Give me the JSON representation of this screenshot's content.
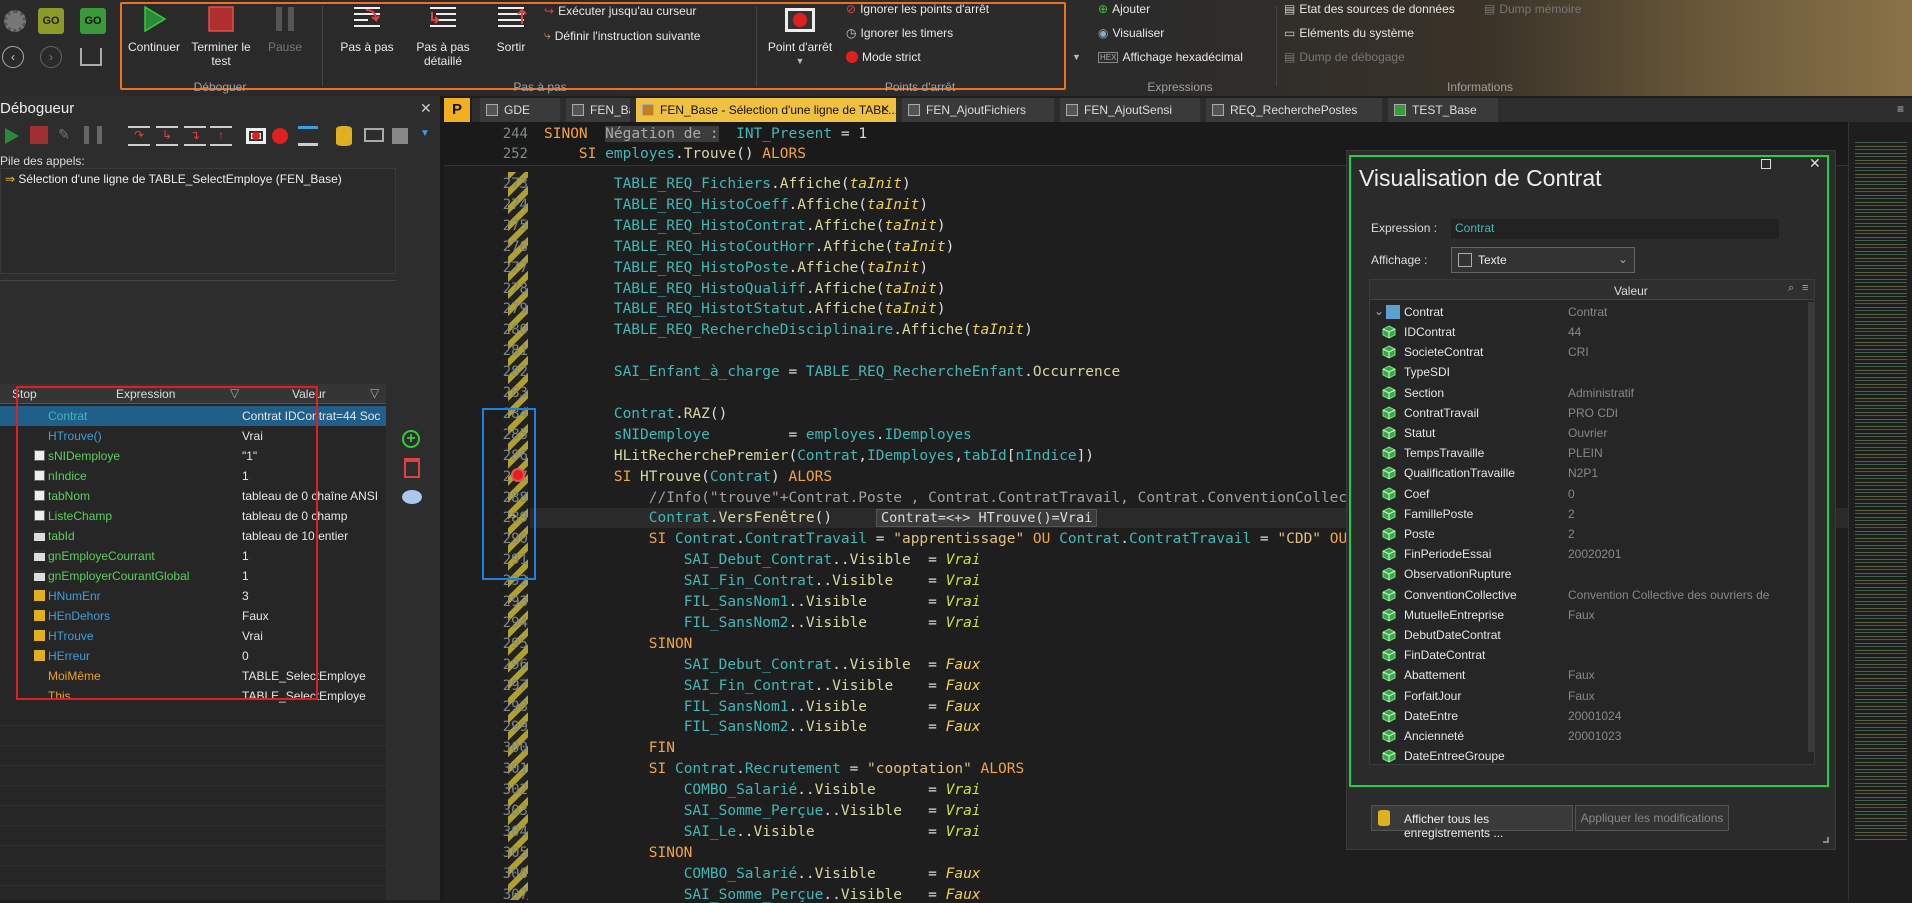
{
  "ribbon": {
    "debug_group": {
      "label": "Déboguer",
      "continue": "Continuer",
      "end_test": "Terminer le test",
      "pause": "Pause"
    },
    "step_group": {
      "label": "Pas à pas",
      "step": "Pas à pas",
      "step_detail": "Pas à pas détaillé",
      "exit": "Sortir",
      "run_to_cursor": "Exécuter jusqu'au curseur",
      "set_next": "Définir l'instruction suivante"
    },
    "breakpoints_group": {
      "label": "Points d'arrêt",
      "breakpoint": "Point d'arrêt",
      "ignore_bp": "Ignorer les points d'arrêt",
      "ignore_timers": "Ignorer les timers",
      "strict_mode": "Mode strict"
    },
    "expressions_group": {
      "label": "Expressions",
      "add": "Ajouter",
      "visualize": "Visualiser",
      "hex": "Affichage hexadécimal"
    },
    "info_group": {
      "label": "Informations",
      "datasources": "Etat des sources de données",
      "system": "Eléments du système",
      "debug_dump": "Dump de débogage",
      "memory_dump": "Dump mémoire"
    },
    "accent_orange": "#f07020",
    "stop_red": "#d04040"
  },
  "tabs": [
    {
      "label": "GDE"
    },
    {
      "label": "FEN_Base"
    },
    {
      "label": "FEN_Base - Sélection d'une ligne de TABL..."
    },
    {
      "label": "FEN_AjoutFichiers"
    },
    {
      "label": "FEN_AjoutSensi"
    },
    {
      "label": "REQ_RecherchePostes"
    },
    {
      "label": "TEST_Base"
    }
  ],
  "debugger": {
    "title": "Débogueur",
    "call_stack_label": "Pile des appels:",
    "call_stack_item": "Sélection d'une ligne de TABLE_SelectEmploye (FEN_Base)",
    "columns": {
      "stop": "Stop",
      "expression": "Expression",
      "value": "Valeur"
    },
    "rows": [
      {
        "expr": "Contrat",
        "value": "Contrat IDContrat=44 Soc",
        "color": "#3fb8b8",
        "icon": "none"
      },
      {
        "expr": "HTrouve()",
        "value": "Vrai",
        "color": "#3aa0e0",
        "icon": "none"
      },
      {
        "expr": "sNIDemploye",
        "value": "\"1\"",
        "color": "#5bd05b",
        "icon": "var"
      },
      {
        "expr": "nIndice",
        "value": "1",
        "color": "#5bd05b",
        "icon": "var"
      },
      {
        "expr": "tabNom",
        "value": "tableau de 0 chaîne ANSI",
        "color": "#5bd05b",
        "icon": "var"
      },
      {
        "expr": "ListeChamp",
        "value": "tableau de 0 champ",
        "color": "#5bd05b",
        "icon": "var"
      },
      {
        "expr": "tabId",
        "value": "tableau de 10 entier",
        "color": "#5bd05b",
        "icon": "local"
      },
      {
        "expr": "gnEmployeCourrant",
        "value": "1",
        "color": "#5bd05b",
        "icon": "local"
      },
      {
        "expr": "gnEmployerCourantGlobal",
        "value": "1",
        "color": "#5bd05b",
        "icon": "local"
      },
      {
        "expr": "HNumEnr",
        "value": "3",
        "color": "#3aa0e0",
        "icon": "h"
      },
      {
        "expr": "HEnDehors",
        "value": "Faux",
        "color": "#3aa0e0",
        "icon": "h"
      },
      {
        "expr": "HTrouve",
        "value": "Vrai",
        "color": "#3aa0e0",
        "icon": "h"
      },
      {
        "expr": "HErreur",
        "value": "0",
        "color": "#3aa0e0",
        "icon": "h"
      },
      {
        "expr": "MoiMême",
        "value": "TABLE_SelectEmploye",
        "color": "#f0a020",
        "icon": "none"
      },
      {
        "expr": "This",
        "value": "TABLE_SelectEmploye",
        "color": "#f0a020",
        "icon": "none"
      }
    ]
  },
  "code": {
    "sticky": [
      {
        "n": "244",
        "html": "<span class=\"kw\">SINON</span>  <span style=\"background:#3c3c3c;color:#aaa\">Négation de :</span>  <span class=\"id\">INT_Present</span> = 1"
      },
      {
        "n": "252",
        "html": "    <span class=\"kw\">SI</span> <span class=\"id\">employes</span>.<span class=\"fn\">Trouve</span>() <span class=\"kw\">ALORS</span>"
      }
    ],
    "lines": [
      {
        "n": "273",
        "html": "        <span class=\"tb2\">TABLE_REQ_Fichiers</span>.<span class=\"fn\">Affiche</span>(<span class=\"it\">taInit</span>)"
      },
      {
        "n": "274",
        "html": "        <span class=\"tb2\">TABLE_REQ_HistoCoeff</span>.<span class=\"fn\">Affiche</span>(<span class=\"it\">taInit</span>)"
      },
      {
        "n": "275",
        "html": "        <span class=\"tb2\">TABLE_REQ_HistoContrat</span>.<span class=\"fn\">Affiche</span>(<span class=\"it\">taInit</span>)"
      },
      {
        "n": "276",
        "html": "        <span class=\"tb2\">TABLE_REQ_HistoCoutHorr</span>.<span class=\"fn\">Affiche</span>(<span class=\"it\">taInit</span>)"
      },
      {
        "n": "277",
        "html": "        <span class=\"tb2\">TABLE_REQ_HistoPoste</span>.<span class=\"fn\">Affiche</span>(<span class=\"it\">taInit</span>)"
      },
      {
        "n": "278",
        "html": "        <span class=\"tb2\">TABLE_REQ_HistoQualiff</span>.<span class=\"fn\">Affiche</span>(<span class=\"it\">taInit</span>)"
      },
      {
        "n": "279",
        "html": "        <span class=\"tb2\">TABLE_REQ_HistotStatut</span>.<span class=\"fn\">Affiche</span>(<span class=\"it\">taInit</span>)"
      },
      {
        "n": "280",
        "html": "        <span class=\"tb2\">TABLE_REQ_RechercheDisciplinaire</span>.<span class=\"fn\">Affiche</span>(<span class=\"it\">taInit</span>)"
      },
      {
        "n": "281",
        "html": ""
      },
      {
        "n": "282",
        "html": "        <span class=\"tb2\">SAI_Enfant_à_charge</span> = <span class=\"tb2\">TABLE_REQ_RechercheEnfant</span>.<span class=\"fn\">Occurrence</span>"
      },
      {
        "n": "283",
        "html": ""
      },
      {
        "n": "284",
        "html": "        <span class=\"id\">Contrat</span>.<span class=\"fn\">RAZ</span>()"
      },
      {
        "n": "285",
        "html": "        <span class=\"id\">sNIDemploye</span>         = <span class=\"id\">employes</span>.<span class=\"id\">IDemployes</span>"
      },
      {
        "n": "286",
        "html": "        <span class=\"fn\">HLitRecherchePremier</span>(<span class=\"id\">Contrat</span>,<span class=\"id\">IDemployes</span>,<span class=\"id\">tabId</span>[<span class=\"id\">nIndice</span>])"
      },
      {
        "n": "287",
        "html": "        <span class=\"kw\">SI</span> <span class=\"fn\">HTrouve</span>(<span class=\"id\">Contrat</span>) <span class=\"kw\">ALORS</span>"
      },
      {
        "n": "288",
        "html": "            <span class=\"cm\">//Info(\"trouve\"+Contrat.Poste , Contrat.ContratTravail, Contrat.ConventionCollect</span>"
      },
      {
        "n": "289",
        "html": "            <span class=\"id\">Contrat</span>.<span class=\"fn\">VersFenêtre</span>()"
      },
      {
        "n": "290",
        "html": "            <span class=\"kw\">SI</span> <span class=\"id\">Contrat</span>.<span class=\"id\">ContratTravail</span> = <span class=\"str\">\"apprentissage\"</span> <span class=\"kw\">OU</span> <span class=\"id\">Contrat</span>.<span class=\"id\">ContratTravail</span> = <span class=\"str\">\"CDD\"</span> <span class=\"kw\">OU</span>"
      },
      {
        "n": "291",
        "html": "                <span class=\"tb2\">SAI_Debut_Contrat</span>..<span class=\"fn\">Visible</span>  = <span class=\"itv\">Vrai</span>"
      },
      {
        "n": "292",
        "html": "                <span class=\"tb2\">SAI_Fin_Contrat</span>..<span class=\"fn\">Visible</span>    = <span class=\"itv\">Vrai</span>"
      },
      {
        "n": "293",
        "html": "                <span class=\"tb2\">FIL_SansNom1</span>..<span class=\"fn\">Visible</span>       = <span class=\"itv\">Vrai</span>"
      },
      {
        "n": "294",
        "html": "                <span class=\"tb2\">FIL_SansNom2</span>..<span class=\"fn\">Visible</span>       = <span class=\"itv\">Vrai</span>"
      },
      {
        "n": "295",
        "html": "            <span class=\"kw\">SINON</span>"
      },
      {
        "n": "296",
        "html": "                <span class=\"tb2\">SAI_Debut_Contrat</span>..<span class=\"fn\">Visible</span>  = <span class=\"it\">Faux</span>"
      },
      {
        "n": "297",
        "html": "                <span class=\"tb2\">SAI_Fin_Contrat</span>..<span class=\"fn\">Visible</span>    = <span class=\"it\">Faux</span>"
      },
      {
        "n": "298",
        "html": "                <span class=\"tb2\">FIL_SansNom1</span>..<span class=\"fn\">Visible</span>       = <span class=\"it\">Faux</span>"
      },
      {
        "n": "299",
        "html": "                <span class=\"tb2\">FIL_SansNom2</span>..<span class=\"fn\">Visible</span>       = <span class=\"it\">Faux</span>"
      },
      {
        "n": "300",
        "html": "            <span class=\"kw\">FIN</span>"
      },
      {
        "n": "301",
        "html": "            <span class=\"kw\">SI</span> <span class=\"id\">Contrat</span>.<span class=\"id\">Recrutement</span> = <span class=\"str\">\"cooptation\"</span> <span class=\"kw\">ALORS</span>"
      },
      {
        "n": "302",
        "html": "                <span class=\"tb2\">COMBO_Salarié</span>..<span class=\"fn\">Visible</span>      = <span class=\"itv\">Vrai</span>"
      },
      {
        "n": "303",
        "html": "                <span class=\"tb2\">SAI_Somme_Perçue</span>..<span class=\"fn\">Visible</span>   = <span class=\"itv\">Vrai</span>"
      },
      {
        "n": "304",
        "html": "                <span class=\"tb2\">SAI_Le</span>..<span class=\"fn\">Visible</span>             = <span class=\"itv\">Vrai</span>"
      },
      {
        "n": "305",
        "html": "            <span class=\"kw\">SINON</span>"
      },
      {
        "n": "306",
        "html": "                <span class=\"tb2\">COMBO_Salarié</span>..<span class=\"fn\">Visible</span>      = <span class=\"it\">Faux</span>"
      },
      {
        "n": "307",
        "html": "                <span class=\"tb2\">SAI_Somme_Perçue</span>..<span class=\"fn\">Visible</span>   = <span class=\"it\">Faux</span>"
      }
    ],
    "tooltip": "Contrat=<+> HTrouve()=Vrai"
  },
  "watch": {
    "title": "Visualisation de Contrat",
    "expr_label": "Expression :",
    "expr_value": "Contrat",
    "display_label": "Affichage :",
    "display_value": "Texte",
    "value_col": "Valeur",
    "root_name": "Contrat",
    "root_value": "Contrat",
    "fields": [
      {
        "name": "IDContrat",
        "value": "44"
      },
      {
        "name": "SocieteContrat",
        "value": "CRI"
      },
      {
        "name": "TypeSDI",
        "value": ""
      },
      {
        "name": "Section",
        "value": "Administratif"
      },
      {
        "name": "ContratTravail",
        "value": "PRO CDI"
      },
      {
        "name": "Statut",
        "value": "Ouvrier"
      },
      {
        "name": "TempsTravaille",
        "value": "PLEIN"
      },
      {
        "name": "QualificationTravaille",
        "value": "N2P1"
      },
      {
        "name": "Coef",
        "value": "0"
      },
      {
        "name": "FamillePoste",
        "value": "2"
      },
      {
        "name": "Poste",
        "value": "2"
      },
      {
        "name": "FinPeriodeEssai",
        "value": "20020201"
      },
      {
        "name": "ObservationRupture",
        "value": ""
      },
      {
        "name": "ConventionCollective",
        "value": "Convention Collective des ouvriers de"
      },
      {
        "name": "MutuelleEntreprise",
        "value": "Faux"
      },
      {
        "name": "DebutDateContrat",
        "value": ""
      },
      {
        "name": "FinDateContrat",
        "value": ""
      },
      {
        "name": "Abattement",
        "value": "Faux"
      },
      {
        "name": "ForfaitJour",
        "value": "Faux"
      },
      {
        "name": "DateEntre",
        "value": "20001024"
      },
      {
        "name": "Ancienneté",
        "value": "20001023"
      },
      {
        "name": "DateEntreeGroupe",
        "value": ""
      }
    ],
    "show_all": "Afficher tous les enregistrements ...",
    "apply": "Appliquer les modifications",
    "border_green": "#20d040"
  }
}
